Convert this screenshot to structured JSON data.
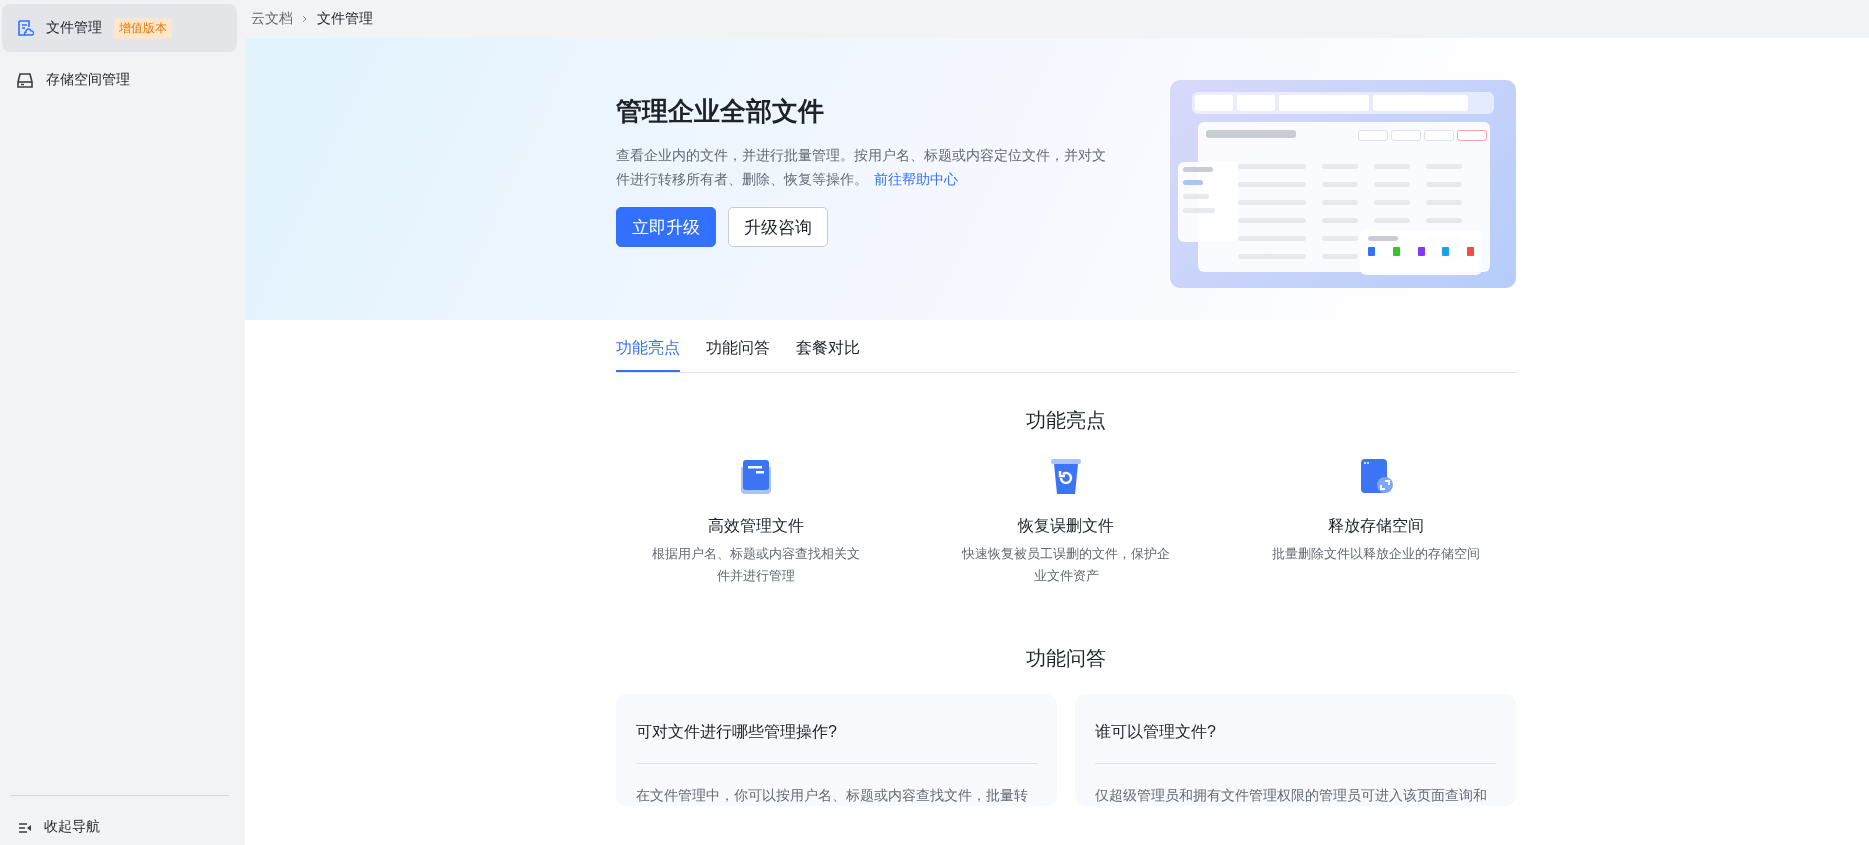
{
  "sidebar": {
    "items": [
      {
        "label": "文件管理",
        "badge": "增值版本",
        "selected": true
      },
      {
        "label": "存储空间管理",
        "selected": false
      }
    ],
    "collapse_label": "收起导航"
  },
  "breadcrumb": [
    "云文档",
    "文件管理"
  ],
  "hero": {
    "title": "管理企业全部文件",
    "description": "查看企业内的文件，并进行批量管理。按用户名、标题或内容定位文件，并对文件进行转移所有者、删除、恢复等操作。",
    "help_link": "前往帮助中心",
    "buttons": [
      {
        "label": "立即升级",
        "kind": "primary"
      },
      {
        "label": "升级咨询",
        "kind": "secondary"
      }
    ]
  },
  "tabs": [
    {
      "label": "功能亮点",
      "selected": true
    },
    {
      "label": "功能问答",
      "selected": false
    },
    {
      "label": "套餐对比",
      "selected": false
    }
  ],
  "highlights": {
    "title": "功能亮点",
    "items": [
      {
        "title": "高效管理文件",
        "description": "根据用户名、标题或内容查找相关文件并进行管理"
      },
      {
        "title": "恢复误删文件",
        "description": "快速恢复被员工误删的文件，保护企业文件资产"
      },
      {
        "title": "释放存储空间",
        "description": "批量删除文件以释放企业的存储空间"
      }
    ]
  },
  "faq": {
    "title": "功能问答",
    "items": [
      {
        "question": "可对文件进行哪些管理操作?",
        "answer": "在文件管理中，你可以按用户名、标题或内容查找文件，批量转"
      },
      {
        "question": "谁可以管理文件?",
        "answer": "仅超级管理员和拥有文件管理权限的管理员可进入该页面查询和"
      }
    ]
  }
}
